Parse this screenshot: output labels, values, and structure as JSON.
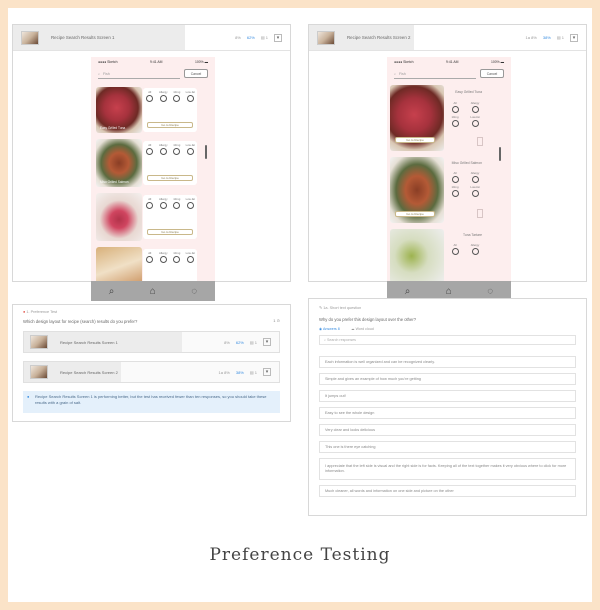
{
  "caption": "Preference Testing",
  "card1": {
    "title": "Recipe Search Results Screen 1",
    "label_left": "8%",
    "percent": "62%",
    "count": "1",
    "expand": "▾"
  },
  "card2": {
    "title": "Recipe Search Results Screen 2",
    "label_left": "1a 8%",
    "percent": "38%",
    "count": "1",
    "expand": "▾"
  },
  "phone": {
    "carrier": "●●●● Sketch",
    "time": "9:41 AM",
    "battery": "100% ▬",
    "search_value": "Fish",
    "cancel": "Cancel",
    "go_to_recipe": "Go to Recipe",
    "cols": [
      "All",
      "Allergy",
      "10mg",
      "Low-fat"
    ]
  },
  "phone2": {
    "titles": [
      "Easy Grilled Tuna",
      "Miso Grilled Salmon",
      "Tuna Tartare"
    ],
    "cols": [
      "All",
      "Allergy",
      "10mg",
      "Low-fat"
    ]
  },
  "pref_card": {
    "header": "1. Preference Test",
    "question": "Which design layout for recipe (search) results do you prefer?",
    "toggle_label": "1",
    "options": [
      {
        "title": "Recipe Search Results Screen 1",
        "left": "8%",
        "percent": "62%",
        "count": "1"
      },
      {
        "title": "Recipe Search Results Screen 2",
        "left": "1a 8%",
        "percent": "38%",
        "count": "1"
      }
    ],
    "note": "Recipe Search Results Screen 1 is performing better, but the test has received fewer than ten responses, so you should take these results with a grain of salt."
  },
  "followup": {
    "header": "1a. Short text question",
    "question": "Why do you prefer this design layout over the other?",
    "tab_answers": "Answers 8",
    "tab_cloud": "Word cloud",
    "search_placeholder": "Search responses",
    "responses": [
      "Each information is well organized and can be recognized clearly.",
      "Simple and gives an example of how much you're getting",
      "It jumps out!",
      "Easy to see the whole design",
      "Very clear and looks delicious",
      "This one is there eye catching",
      "I appreciate that the left side is visual and the right side is for facts. Keeping all of the text together makes it very obvious where to click for more information.",
      "Much cleaner, all words and information on one side and picture on the other"
    ]
  }
}
